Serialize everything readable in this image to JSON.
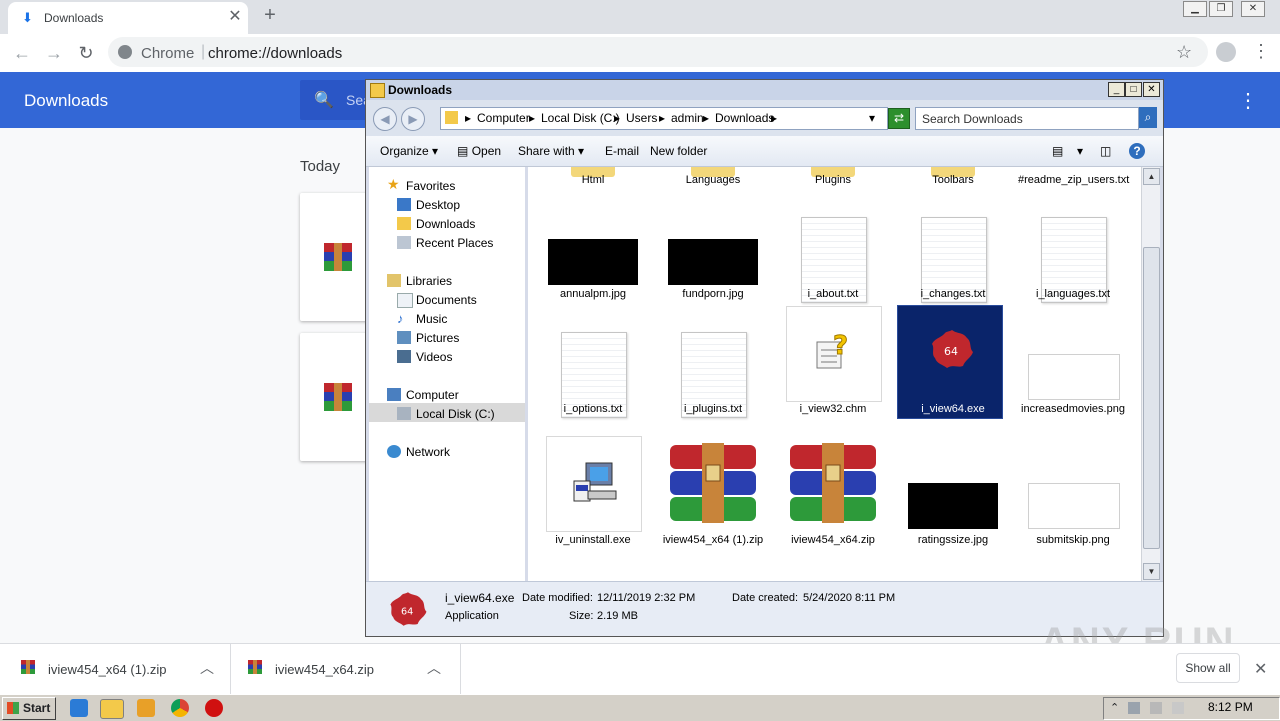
{
  "browser": {
    "tab_title": "Downloads",
    "omnibox_site": "Chrome",
    "omnibox_url": "chrome://downloads"
  },
  "downloads_page": {
    "title": "Downloads",
    "search_placeholder": "Sea",
    "section": "Today"
  },
  "explorer": {
    "title": "Downloads",
    "breadcrumb": [
      "Computer",
      "Local Disk (C:)",
      "Users",
      "admin",
      "Downloads"
    ],
    "search_placeholder": "Search Downloads",
    "commands": {
      "organize": "Organize",
      "open": "Open",
      "share_with": "Share with",
      "email": "E-mail",
      "new_folder": "New folder"
    },
    "nav": {
      "favorites": "Favorites",
      "desktop": "Desktop",
      "downloads": "Downloads",
      "recent_places": "Recent Places",
      "libraries": "Libraries",
      "documents": "Documents",
      "music": "Music",
      "pictures": "Pictures",
      "videos": "Videos",
      "computer": "Computer",
      "local_disk": "Local Disk (C:)",
      "network": "Network"
    },
    "files": {
      "f1": "Html",
      "f2": "Languages",
      "f3": "Plugins",
      "f4": "Toolbars",
      "f5": "#readme_zip_users.txt",
      "f6": "annualpm.jpg",
      "f7": "fundporn.jpg",
      "f8": "i_about.txt",
      "f9": "i_changes.txt",
      "f10": "i_languages.txt",
      "f11": "i_options.txt",
      "f12": "i_plugins.txt",
      "f13": "i_view32.chm",
      "f14": "i_view64.exe",
      "f15": "increasedmovies.png",
      "f16": "iv_uninstall.exe",
      "f17": "iview454_x64 (1).zip",
      "f18": "iview454_x64.zip",
      "f19": "ratingssize.jpg",
      "f20": "submitskip.png"
    },
    "details": {
      "name": "i_view64.exe",
      "type": "Application",
      "modified_label": "Date modified:",
      "modified_value": "12/11/2019 2:32 PM",
      "created_label": "Date created:",
      "created_value": "5/24/2020 8:11 PM",
      "size_label": "Size:",
      "size_value": "2.19 MB"
    }
  },
  "shelf": {
    "item1": "iview454_x64 (1).zip",
    "item2": "iview454_x64.zip",
    "show_all": "Show all"
  },
  "taskbar": {
    "start": "Start",
    "clock": "8:12 PM"
  },
  "watermark": "ANY RUN",
  "colors": {
    "downloads_header": "#3367d6",
    "selection": "#0a246a",
    "winrar_red": "#c0272d",
    "winrar_blue": "#2a3fb0",
    "winrar_green": "#2d9a3a"
  }
}
